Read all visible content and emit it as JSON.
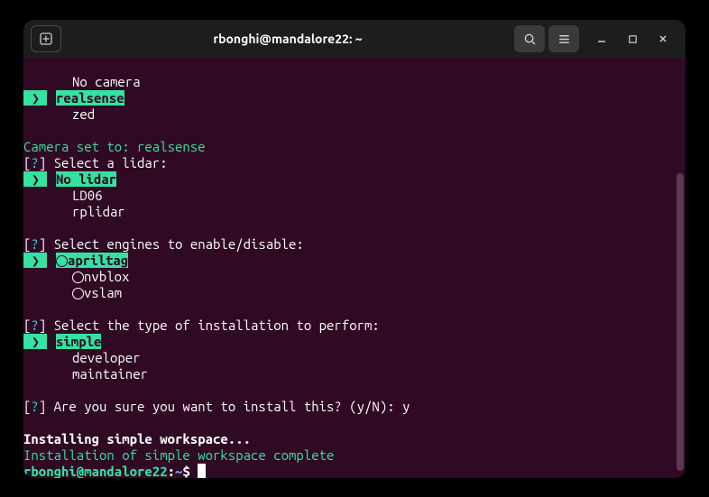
{
  "titlebar": {
    "title": "rbonghi@mandalore22: ~"
  },
  "terminal": {
    "camera_options": {
      "none": "No camera",
      "selected": "realsense",
      "zed": "zed"
    },
    "camera_set": "Camera set to: realsense",
    "lidar_prompt": "Select a lidar:",
    "lidar_options": {
      "selected": "No lidar",
      "ld06": "LD06",
      "rplidar": "rplidar"
    },
    "engines_prompt": "Select engines to enable/disable:",
    "engines": {
      "apriltag": "apriltag",
      "nvblox": "nvblox",
      "vslam": "vslam"
    },
    "install_type_prompt": "Select the type of installation to perform:",
    "install_types": {
      "selected": "simple",
      "developer": "developer",
      "maintainer": "maintainer"
    },
    "confirm_prompt": "Are you sure you want to install this? (y/N): y",
    "installing": "Installing simple workspace...",
    "complete": "Installation of simple workspace complete",
    "prompt": {
      "user": "rbonghi@mandalore22",
      "path": "~",
      "dollar": "$"
    }
  }
}
